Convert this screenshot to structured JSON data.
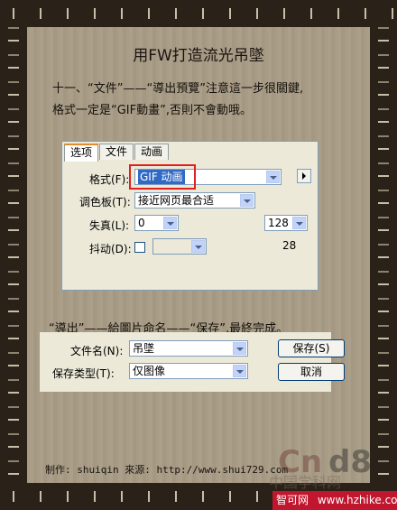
{
  "article": {
    "title": "用FW打造流光吊墜",
    "step1_line1": "十一、“文件”——“導出預覽”注意這一步很關鍵,",
    "step1_line2": "格式一定是“GIF動畫”,否則不會動哦。",
    "step2": "“導出”——給圖片命名——“保存”,最終完成。",
    "credits": "制作: shuiqin    來源: http://www.shui729.com"
  },
  "export_dialog": {
    "tabs": [
      "选项",
      "文件",
      "动画"
    ],
    "active_tab": "选项",
    "format_label": "格式(F):",
    "format_value": "GIF 动画",
    "palette_label": "调色板(T):",
    "palette_value": "接近网页最合适",
    "loss_label": "失真(L):",
    "loss_value": "0",
    "dither_label": "抖动(D):",
    "colors_value": "128",
    "colors_count": "28"
  },
  "save_dialog": {
    "filename_label": "文件名(N):",
    "filename_value": "吊墜",
    "filetype_label": "保存类型(T):",
    "filetype_value": "仅图像",
    "save_button": "保存(S)",
    "cancel_button": "取消"
  },
  "watermark": {
    "logo_cn": "Cn",
    "logo_d8": "d8",
    "site_cn": "智可网",
    "site_url": "www.hzhike.com",
    "ghost_text": "中国学科网"
  },
  "colors": {
    "accent_red": "#e02020",
    "selection_blue": "#316ac5"
  }
}
